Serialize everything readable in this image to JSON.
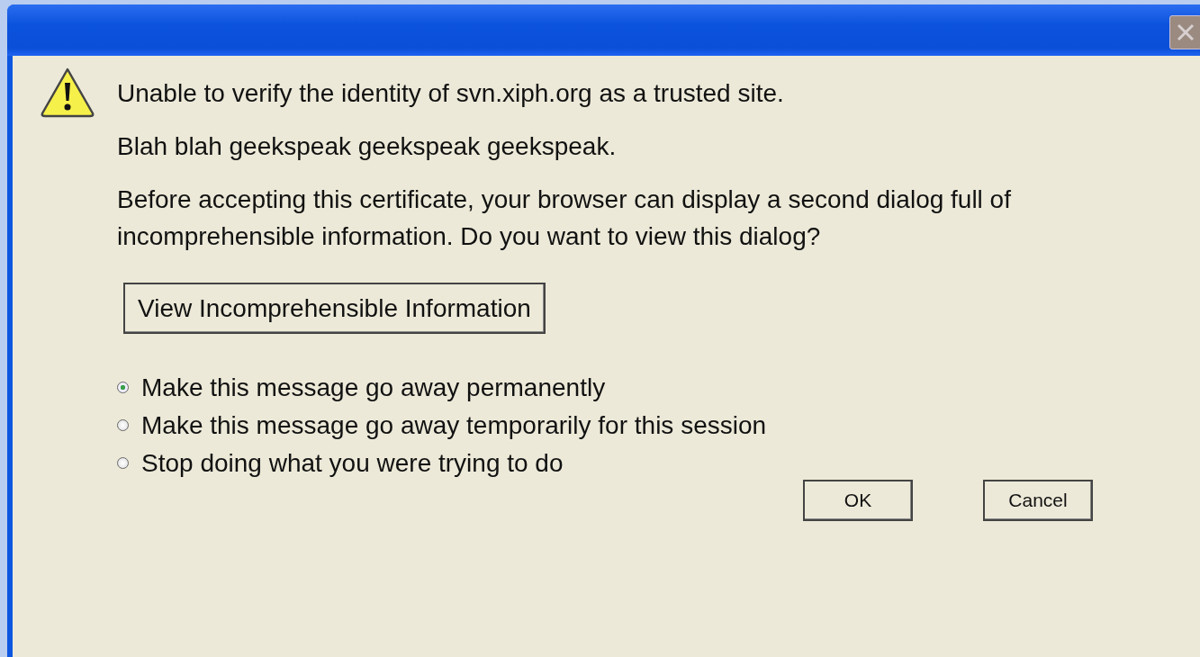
{
  "dialog": {
    "heading": "Unable to verify the identity of svn.xiph.org as a trusted site.",
    "paragraphs": [
      "Blah blah geekspeak geekspeak geekspeak.",
      "Before accepting this certificate, your browser can display a second dialog full of incomprehensible information. Do you want to view this dialog?"
    ],
    "view_button": "View Incomprehensible Information",
    "options": [
      {
        "label": "Make this message go away permanently",
        "selected": true
      },
      {
        "label": "Make this message go away temporarily for this session",
        "selected": false
      },
      {
        "label": "Stop doing what you were trying to do",
        "selected": false
      }
    ],
    "buttons": [
      "OK",
      "Cancel"
    ]
  }
}
